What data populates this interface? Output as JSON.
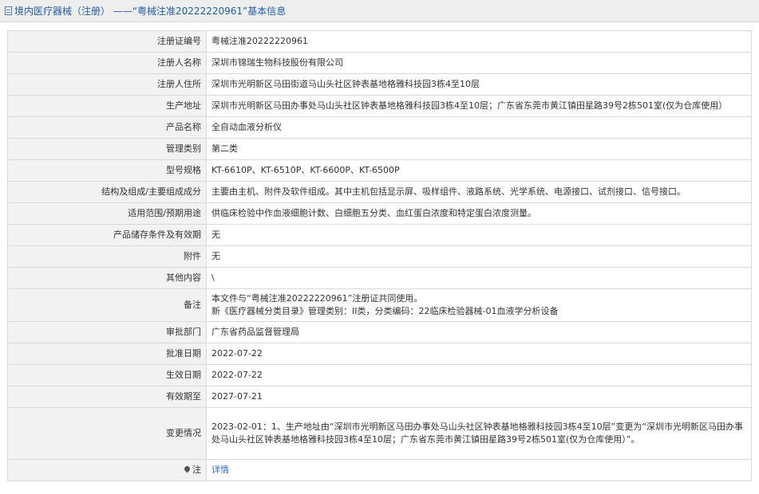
{
  "header": {
    "title": "境内医疗器械（注册） ——“粤械注准20222220961”基本信息"
  },
  "rows": [
    {
      "label": "注册证编号",
      "value": "粤械注准20222220961"
    },
    {
      "label": "注册人名称",
      "value": "深圳市锦瑞生物科技股份有限公司"
    },
    {
      "label": "注册人住所",
      "value": "深圳市光明新区马田街道马山头社区钟表基地格雅科技园3栋4至10层"
    },
    {
      "label": "生产地址",
      "value": "深圳市光明新区马田办事处马山头社区钟表基地格雅科技园3栋4至10层；广东省东莞市黄江镇田星路39号2栋501室(仅为仓库使用）"
    },
    {
      "label": "产品名称",
      "value": "全自动血液分析仪"
    },
    {
      "label": "管理类别",
      "value": "第二类"
    },
    {
      "label": "型号规格",
      "value": "KT-6610P、KT-6510P、KT-6600P、KT-6500P"
    },
    {
      "label": "结构及组成/主要组成成分",
      "value": "主要由主机、附件及软件组成。其中主机包括显示屏、吸样组件、液路系统、光学系统、电源接口、试剂接口、信号接口。"
    },
    {
      "label": "适用范围/预期用途",
      "value": "供临床检验中作血液细胞计数、白细胞五分类、血红蛋白浓度和特定蛋白浓度测量。"
    },
    {
      "label": "产品储存条件及有效期",
      "value": "无"
    },
    {
      "label": "附件",
      "value": "无"
    },
    {
      "label": "其他内容",
      "value": "\\"
    },
    {
      "label": "备注",
      "value_line1": "本文件与“粤械注准20222220961”注册证共同使用。",
      "value_line2": "新《医疗器械分类目录》管理类别：II类，分类编码：22临床检验器械-01血液学分析设备"
    },
    {
      "label": "审批部门",
      "value": "广东省药品监督管理局"
    },
    {
      "label": "批准日期",
      "value": "2022-07-22"
    },
    {
      "label": "生效日期",
      "value": "2022-07-22"
    },
    {
      "label": "有效期至",
      "value": "2027-07-21"
    },
    {
      "label": "变更情况",
      "value": "2023-02-01：1、生产地址由“深圳市光明新区马田办事处马山头社区钟表基地格雅科技园3栋4至10层”变更为“深圳市光明新区马田办事处马山头社区钟表基地格雅科技园3栋4至10层；广东省东莞市黄江镇田星路39号2栋501室(仅为仓库使用）”。"
    },
    {
      "label": "注",
      "value": "详情"
    }
  ],
  "icons": {
    "header": "document-icon",
    "note": "location-pin-icon"
  },
  "colors": {
    "header_text": "#1f5ea8",
    "link": "#2b6cc4",
    "label_bg": "#f2f2f2"
  }
}
